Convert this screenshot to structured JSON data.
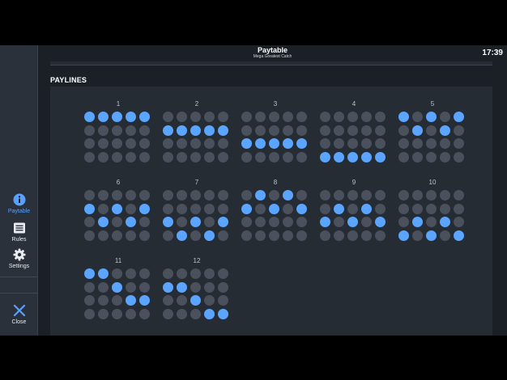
{
  "header": {
    "title": "Paytable",
    "subtitle": "Mega Greatest Catch",
    "clock": "17:39"
  },
  "sidebar": {
    "items": [
      {
        "label": "Paytable",
        "icon": "info-icon",
        "active": true
      },
      {
        "label": "Rules",
        "icon": "rules-icon",
        "active": false
      },
      {
        "label": "Settings",
        "icon": "gear-icon",
        "active": false
      },
      {
        "label": "Close",
        "icon": "close-icon",
        "active": false
      }
    ]
  },
  "section": {
    "title": "PAYLINES"
  },
  "colors": {
    "active_dot": "#5ba4ff",
    "inactive_dot": "#4a515c",
    "accent": "#5aa0ff"
  },
  "paylines": [
    {
      "number": "1",
      "pattern": [
        "11111",
        "00000",
        "00000",
        "00000"
      ]
    },
    {
      "number": "2",
      "pattern": [
        "00000",
        "11111",
        "00000",
        "00000"
      ]
    },
    {
      "number": "3",
      "pattern": [
        "00000",
        "00000",
        "11111",
        "00000"
      ]
    },
    {
      "number": "4",
      "pattern": [
        "00000",
        "00000",
        "00000",
        "11111"
      ]
    },
    {
      "number": "5",
      "pattern": [
        "10101",
        "01010",
        "00000",
        "00000"
      ]
    },
    {
      "number": "6",
      "pattern": [
        "00000",
        "10101",
        "01010",
        "00000"
      ]
    },
    {
      "number": "7",
      "pattern": [
        "00000",
        "00000",
        "10101",
        "01010"
      ]
    },
    {
      "number": "8",
      "pattern": [
        "01010",
        "10101",
        "00000",
        "00000"
      ]
    },
    {
      "number": "9",
      "pattern": [
        "00000",
        "01010",
        "10101",
        "00000"
      ]
    },
    {
      "number": "10",
      "pattern": [
        "00000",
        "00000",
        "01010",
        "10101"
      ]
    },
    {
      "number": "11",
      "pattern": [
        "11000",
        "00100",
        "00011",
        "00000"
      ]
    },
    {
      "number": "12",
      "pattern": [
        "00000",
        "11000",
        "00100",
        "00011"
      ]
    }
  ]
}
